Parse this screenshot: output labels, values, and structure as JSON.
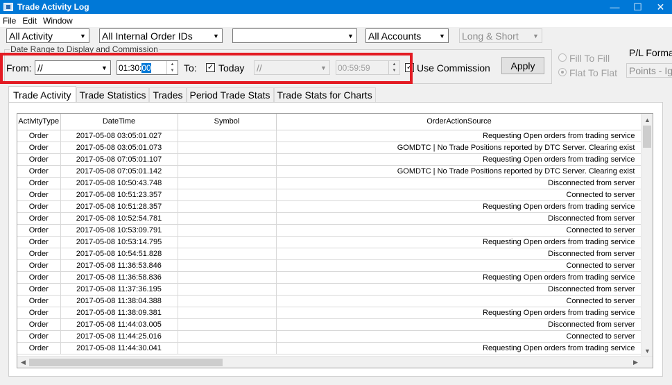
{
  "window": {
    "title": "Trade Activity Log",
    "minimize": "—",
    "maximize": "☐",
    "close": "✕"
  },
  "menu": [
    "File",
    "Edit",
    "Window"
  ],
  "filters": {
    "activity": "All Activity",
    "order_ids": "All Internal Order IDs",
    "symbol": "",
    "accounts": "All Accounts",
    "side": "Long & Short"
  },
  "date_range": {
    "group_label": "Date Range to Display and Commission",
    "from_label": "From:",
    "from_date": "//",
    "from_time_pre": "01:30:",
    "from_time_sel": "00",
    "to_label": "To:",
    "today_checked": true,
    "today_label": "Today",
    "to_date": "//",
    "to_time": "00:59:59",
    "commission_checked": true,
    "commission_label": "Use Commission",
    "apply_label": "Apply"
  },
  "fill_options": {
    "fill_to_fill": "Fill To Fill",
    "flat_to_flat": "Flat To Flat",
    "selected": "flat_to_flat"
  },
  "pl_format": {
    "label": "P/L Format",
    "value": "Points - Ignore"
  },
  "tabs": [
    "Trade Activity",
    "Trade Statistics",
    "Trades",
    "Period Trade Stats",
    "Trade Stats for Charts"
  ],
  "active_tab": "Trade Activity",
  "table": {
    "columns": [
      "ActivityType",
      "DateTime",
      "Symbol",
      "OrderActionSource"
    ],
    "rows": [
      [
        "Order",
        "2017-05-08 03:05:01.027",
        "",
        "Requesting Open orders from trading service"
      ],
      [
        "Order",
        "2017-05-08 03:05:01.073",
        "",
        "GOMDTC | No Trade Positions reported by DTC Server. Clearing exist"
      ],
      [
        "Order",
        "2017-05-08 07:05:01.107",
        "",
        "Requesting Open orders from trading service"
      ],
      [
        "Order",
        "2017-05-08 07:05:01.142",
        "",
        "GOMDTC | No Trade Positions reported by DTC Server. Clearing exist"
      ],
      [
        "Order",
        "2017-05-08 10:50:43.748",
        "",
        "Disconnected from server"
      ],
      [
        "Order",
        "2017-05-08 10:51:23.357",
        "",
        "Connected to server"
      ],
      [
        "Order",
        "2017-05-08 10:51:28.357",
        "",
        "Requesting Open orders from trading service"
      ],
      [
        "Order",
        "2017-05-08 10:52:54.781",
        "",
        "Disconnected from server"
      ],
      [
        "Order",
        "2017-05-08 10:53:09.791",
        "",
        "Connected to server"
      ],
      [
        "Order",
        "2017-05-08 10:53:14.795",
        "",
        "Requesting Open orders from trading service"
      ],
      [
        "Order",
        "2017-05-08 10:54:51.828",
        "",
        "Disconnected from server"
      ],
      [
        "Order",
        "2017-05-08 11:36:53.846",
        "",
        "Connected to server"
      ],
      [
        "Order",
        "2017-05-08 11:36:58.836",
        "",
        "Requesting Open orders from trading service"
      ],
      [
        "Order",
        "2017-05-08 11:37:36.195",
        "",
        "Disconnected from server"
      ],
      [
        "Order",
        "2017-05-08 11:38:04.388",
        "",
        "Connected to server"
      ],
      [
        "Order",
        "2017-05-08 11:38:09.381",
        "",
        "Requesting Open orders from trading service"
      ],
      [
        "Order",
        "2017-05-08 11:44:03.005",
        "",
        "Disconnected from server"
      ],
      [
        "Order",
        "2017-05-08 11:44:25.016",
        "",
        "Connected to server"
      ],
      [
        "Order",
        "2017-05-08 11:44:30.041",
        "",
        "Requesting Open orders from trading service"
      ]
    ]
  }
}
